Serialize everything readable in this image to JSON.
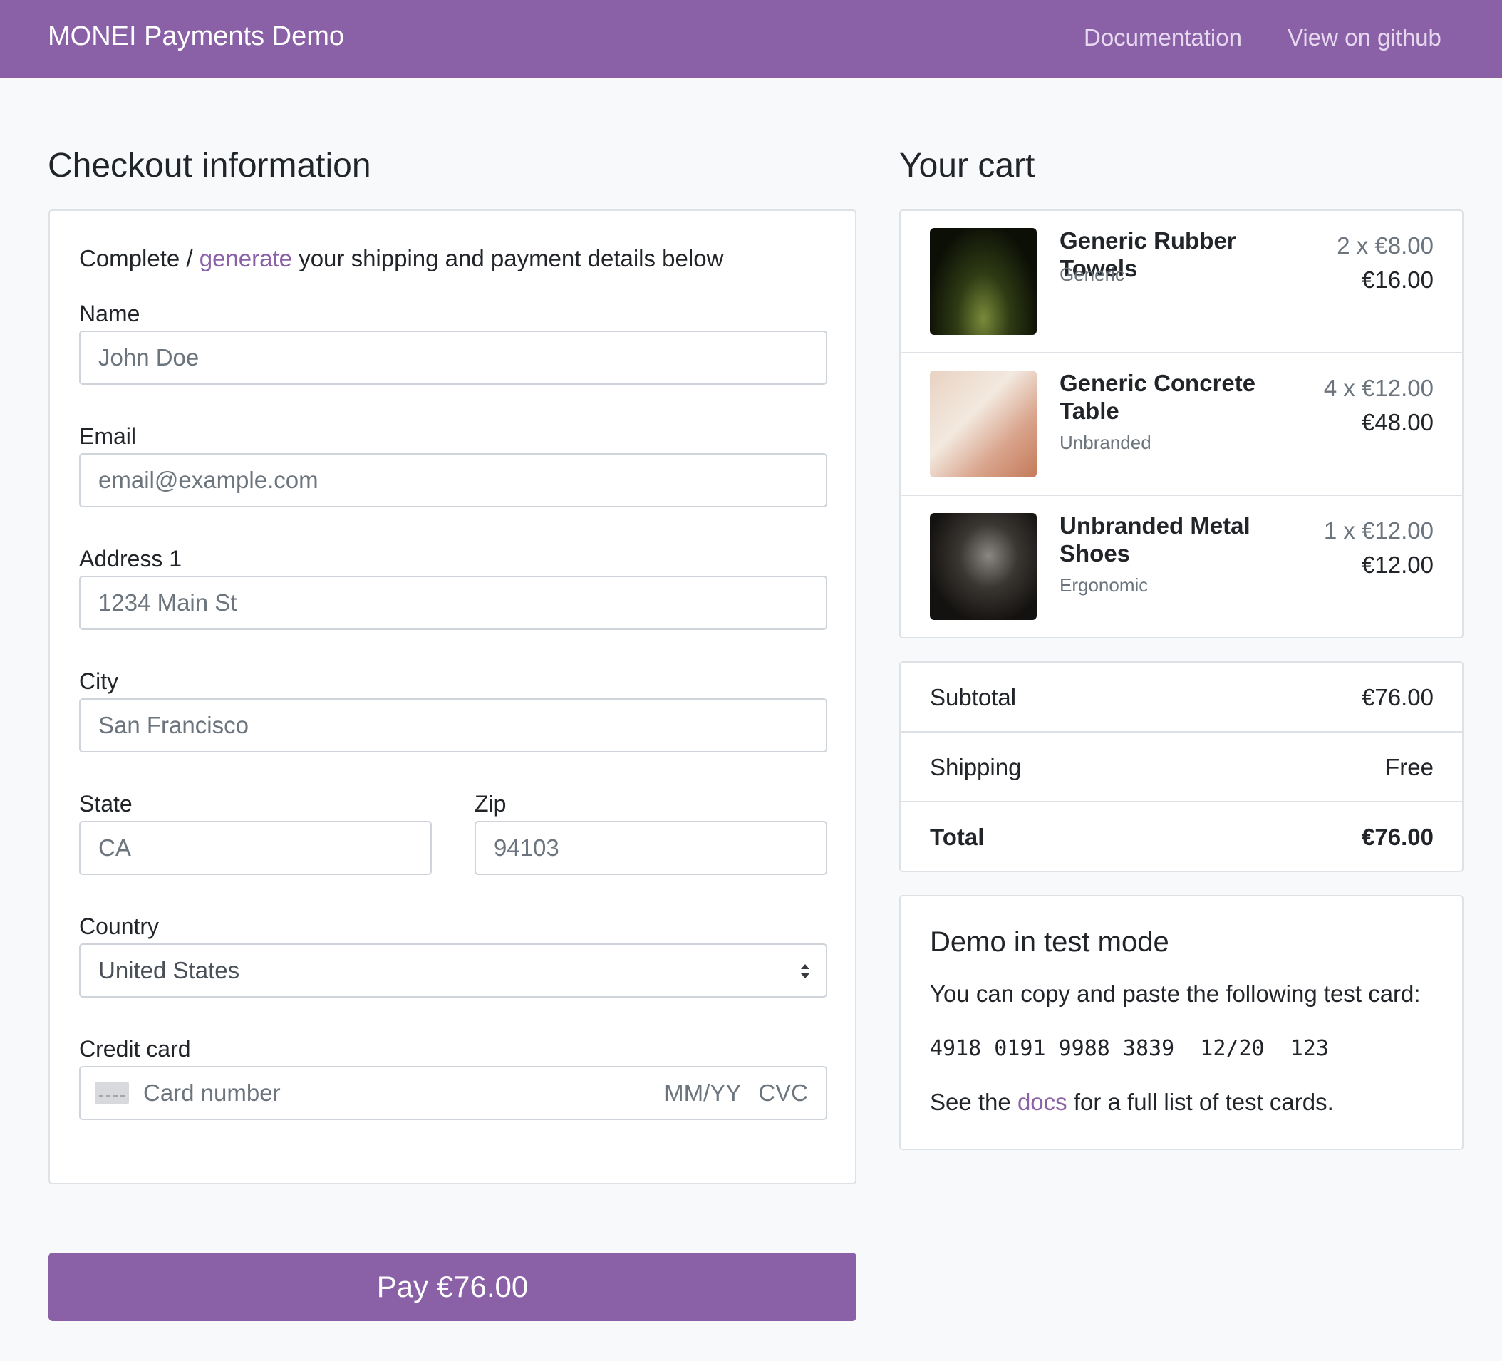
{
  "navbar": {
    "brand": "MONEI Payments Demo",
    "links": [
      "Documentation",
      "View on github"
    ]
  },
  "checkout": {
    "title": "Checkout information",
    "intro_prefix": "Complete / ",
    "intro_link": "generate",
    "intro_suffix": " your shipping and payment details below",
    "fields": {
      "name": {
        "label": "Name",
        "value": "John Doe"
      },
      "email": {
        "label": "Email",
        "value": "email@example.com"
      },
      "address": {
        "label": "Address 1",
        "value": "1234 Main St"
      },
      "city": {
        "label": "City",
        "value": "San Francisco"
      },
      "state": {
        "label": "State",
        "value": "CA"
      },
      "zip": {
        "label": "Zip",
        "value": "94103"
      },
      "country": {
        "label": "Country",
        "value": "United States"
      },
      "card": {
        "label": "Credit card",
        "placeholder": "Card number",
        "expiry_placeholder": "MM/YY",
        "cvc_placeholder": "CVC"
      }
    },
    "pay_button": "Pay €76.00"
  },
  "cart": {
    "title": "Your cart",
    "items": [
      {
        "name": "Generic Rubber Towels",
        "brand": "Generic",
        "qty_price": "2 x €8.00",
        "total": "€16.00"
      },
      {
        "name": "Generic Concrete Table",
        "brand": "Unbranded",
        "qty_price": "4 x €12.00",
        "total": "€48.00"
      },
      {
        "name": "Unbranded Metal Shoes",
        "brand": "Ergonomic",
        "qty_price": "1 x €12.00",
        "total": "€12.00"
      }
    ],
    "summary": [
      {
        "label": "Subtotal",
        "value": "€76.00"
      },
      {
        "label": "Shipping",
        "value": "Free"
      },
      {
        "label": "Total",
        "value": "€76.00"
      }
    ]
  },
  "test_mode": {
    "title": "Demo in test mode",
    "text": "You can copy and paste the following test card:",
    "card_line": "4918 0191 9988 3839  12/20  123",
    "footer_prefix": "See the ",
    "footer_link": "docs",
    "footer_suffix": " for a full list of test cards."
  },
  "colors": {
    "brand": "#8a60a7",
    "background": "#f8f9fa",
    "border": "#dee2e6",
    "muted": "#6c757d"
  },
  "icons": [
    "select-arrows-icon",
    "credit-card-icon"
  ]
}
